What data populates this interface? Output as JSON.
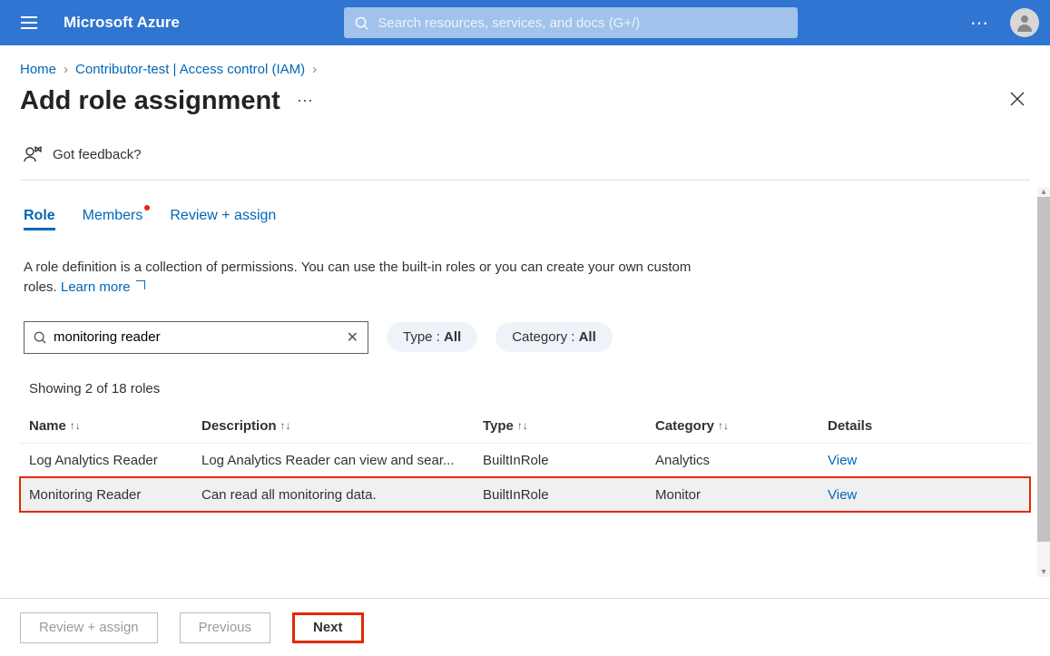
{
  "topbar": {
    "brand": "Microsoft Azure",
    "search_placeholder": "Search resources, services, and docs (G+/)"
  },
  "breadcrumbs": {
    "home": "Home",
    "current": "Contributor-test | Access control (IAM)"
  },
  "page": {
    "title": "Add role assignment",
    "feedback": "Got feedback?"
  },
  "tabs": {
    "role": "Role",
    "members": "Members",
    "review": "Review + assign"
  },
  "description": {
    "text": "A role definition is a collection of permissions. You can use the built-in roles or you can create your own custom roles. ",
    "learn": "Learn more"
  },
  "filters": {
    "search_value": "monitoring reader",
    "type_label": "Type : ",
    "type_value": "All",
    "category_label": "Category : ",
    "category_value": "All"
  },
  "results": {
    "count_text": "Showing 2 of 18 roles"
  },
  "columns": {
    "name": "Name",
    "description": "Description",
    "type": "Type",
    "category": "Category",
    "details": "Details"
  },
  "rows": [
    {
      "name": "Log Analytics Reader",
      "description": "Log Analytics Reader can view and sear...",
      "type": "BuiltInRole",
      "category": "Analytics",
      "view": "View"
    },
    {
      "name": "Monitoring Reader",
      "description": "Can read all monitoring data.",
      "type": "BuiltInRole",
      "category": "Monitor",
      "view": "View"
    }
  ],
  "footer": {
    "review": "Review + assign",
    "previous": "Previous",
    "next": "Next"
  }
}
